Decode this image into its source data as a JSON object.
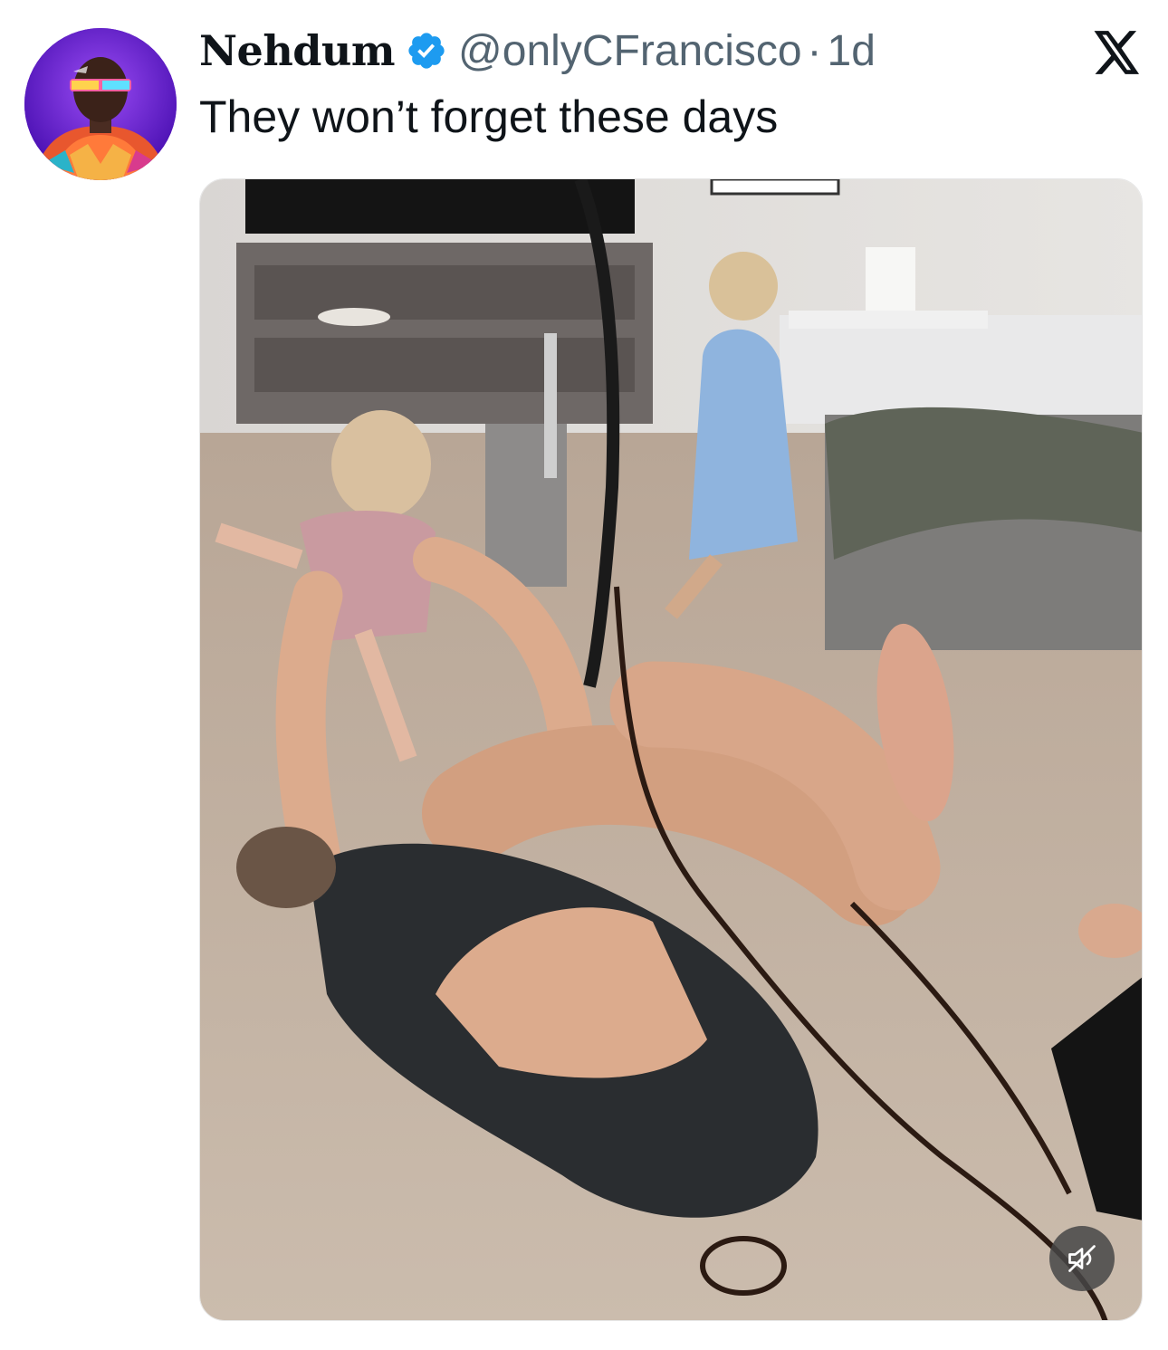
{
  "author": {
    "display_name": "Nehdum",
    "handle": "@onlyCFrancisco",
    "separator": "·",
    "time": "1d",
    "verified": true,
    "avatar_icon": "user-avatar"
  },
  "tweet": {
    "text": "They won’t forget these days"
  },
  "media": {
    "type": "video",
    "mute_icon": "speaker-muted-icon"
  },
  "platform_icon": "x-logo-icon",
  "colors": {
    "text_primary": "#0f1419",
    "text_secondary": "#536471",
    "verified_blue": "#1d9bf0"
  }
}
